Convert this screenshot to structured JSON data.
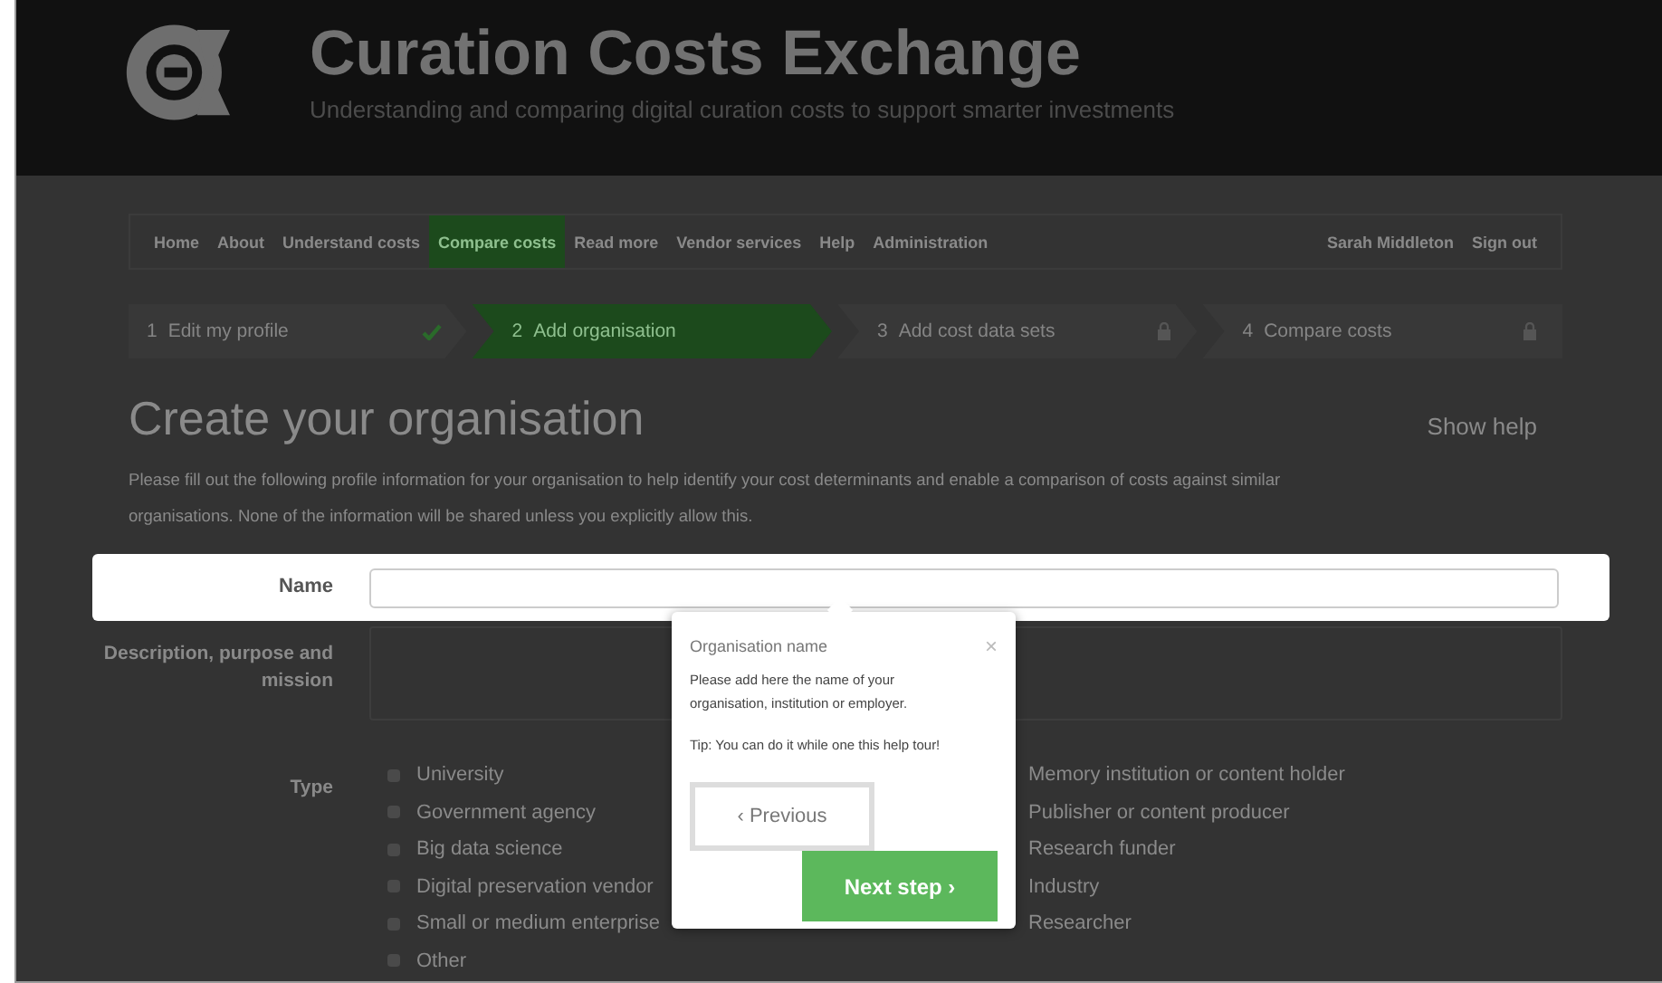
{
  "header": {
    "title": "Curation Costs Exchange",
    "subtitle": "Understanding and comparing digital curation costs to support smarter investments"
  },
  "nav": {
    "items": [
      {
        "label": "Home",
        "selected": false
      },
      {
        "label": "About",
        "selected": false
      },
      {
        "label": "Understand costs",
        "selected": false
      },
      {
        "label": "Compare costs",
        "selected": true
      },
      {
        "label": "Read more",
        "selected": false
      },
      {
        "label": "Vendor services",
        "selected": false
      },
      {
        "label": "Help",
        "selected": false
      },
      {
        "label": "Administration",
        "selected": false
      }
    ],
    "user_items": [
      "Sarah Middleton",
      "Sign out"
    ]
  },
  "steps": [
    {
      "number": "1",
      "label": "Edit my profile",
      "kind": "done",
      "selected": false
    },
    {
      "number": "2",
      "label": "Add organisation",
      "kind": "current",
      "selected": true
    },
    {
      "number": "3",
      "label": "Add cost data sets",
      "kind": "locked",
      "selected": false
    },
    {
      "number": "4",
      "label": "Compare costs",
      "kind": "locked",
      "selected": false
    }
  ],
  "page": {
    "heading": "Create your organisation",
    "help_link": "Show help",
    "intro": "Please fill out the following profile information for your organisation to help identify your cost determinants and enable a comparison of costs against similar organisations. None of the information will be shared unless you explicitly allow this."
  },
  "form": {
    "name_label": "Name",
    "description_label": "Description, purpose and mission",
    "type_label": "Type",
    "types_col1": [
      {
        "label": "University",
        "checked": false
      },
      {
        "label": "Government agency",
        "checked": false
      },
      {
        "label": "Big data science",
        "checked": false
      },
      {
        "label": "Digital preservation vendor",
        "checked": false
      },
      {
        "label": "Small or medium enterprise",
        "checked": false
      },
      {
        "label": "Other",
        "checked": false
      }
    ],
    "types_col2": [
      "Memory institution or content holder",
      "Publisher or content producer",
      "Research funder",
      "Industry",
      "Researcher"
    ]
  },
  "tour_popover": {
    "title": "Organisation name",
    "close": "×",
    "body": "Please add here the name of your organisation, institution or employer.",
    "tip": "Tip: You can do it while one this help tour!",
    "previous": "‹ Previous",
    "next": "Next step ›"
  }
}
